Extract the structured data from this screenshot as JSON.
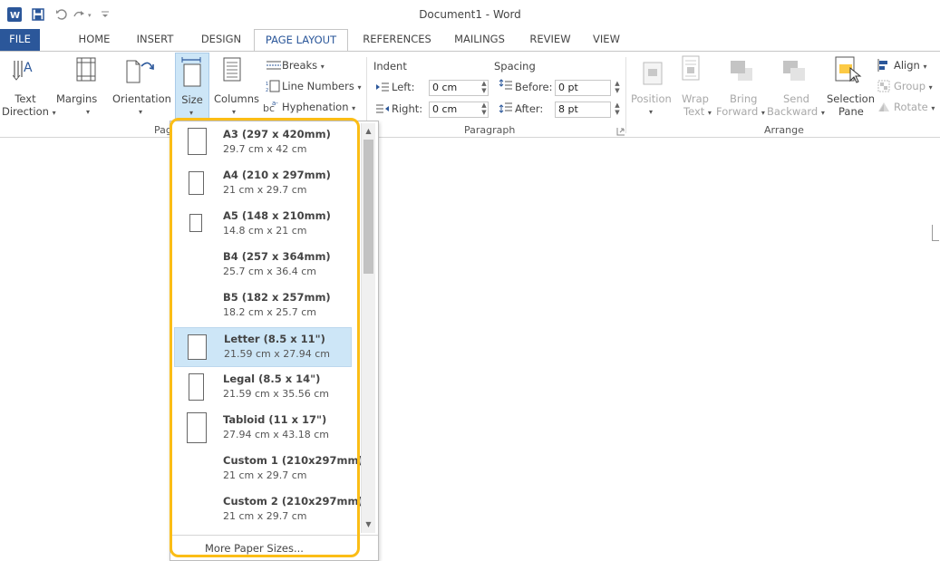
{
  "window": {
    "title": "Document1 - Word"
  },
  "tabs": [
    "FILE",
    "HOME",
    "INSERT",
    "DESIGN",
    "PAGE LAYOUT",
    "REFERENCES",
    "MAILINGS",
    "REVIEW",
    "VIEW"
  ],
  "active_tab": "PAGE LAYOUT",
  "ribbon": {
    "text_direction": [
      "Text",
      "Direction"
    ],
    "margins": "Margins",
    "orientation": "Orientation",
    "size": "Size",
    "columns": "Columns",
    "breaks": "Breaks",
    "line_numbers": "Line Numbers",
    "hyphenation": "Hyphenation",
    "page_setup_group": "Pag",
    "indent": {
      "header": "Indent",
      "left_label": "Left:",
      "left_value": "0 cm",
      "right_label": "Right:",
      "right_value": "0 cm"
    },
    "spacing": {
      "header": "Spacing",
      "before_label": "Before:",
      "before_value": "0 pt",
      "after_label": "After:",
      "after_value": "8 pt"
    },
    "paragraph_group": "Paragraph",
    "arrange": {
      "position": "Position",
      "wrap_text": [
        "Wrap",
        "Text"
      ],
      "bring_forward": [
        "Bring",
        "Forward"
      ],
      "send_backward": [
        "Send",
        "Backward"
      ],
      "selection_pane": [
        "Selection",
        "Pane"
      ],
      "align": "Align",
      "group": "Group",
      "rotate": "Rotate",
      "group_label": "Arrange"
    }
  },
  "paper_sizes": [
    {
      "name": "A3 (297 x 420mm)",
      "dims": "29.7 cm x 42 cm"
    },
    {
      "name": "A4 (210 x 297mm)",
      "dims": "21 cm x 29.7 cm"
    },
    {
      "name": "A5 (148 x 210mm)",
      "dims": "14.8 cm x 21 cm"
    },
    {
      "name": "B4 (257 x 364mm)",
      "dims": "25.7 cm x 36.4 cm"
    },
    {
      "name": "B5 (182 x 257mm)",
      "dims": "18.2 cm x 25.7 cm"
    },
    {
      "name": "Letter (8.5 x 11\")",
      "dims": "21.59 cm x 27.94 cm"
    },
    {
      "name": "Legal (8.5 x 14\")",
      "dims": "21.59 cm x 35.56 cm"
    },
    {
      "name": "Tabloid (11 x 17\")",
      "dims": "27.94 cm x 43.18 cm"
    },
    {
      "name": "Custom 1 (210x297mm)",
      "dims": "21 cm x 29.7 cm"
    },
    {
      "name": "Custom 2 (210x297mm)",
      "dims": "21 cm x 29.7 cm"
    }
  ],
  "selected_paper_size": "Letter (8.5 x 11\")",
  "more_paper_sizes": "More Paper Sizes...",
  "colors": {
    "accent": "#2b579a",
    "highlight": "#fbbd16",
    "selected": "#cde6f7"
  },
  "icons": [
    "word-logo-icon",
    "save-icon",
    "undo-icon",
    "redo-icon",
    "customize-icon"
  ]
}
